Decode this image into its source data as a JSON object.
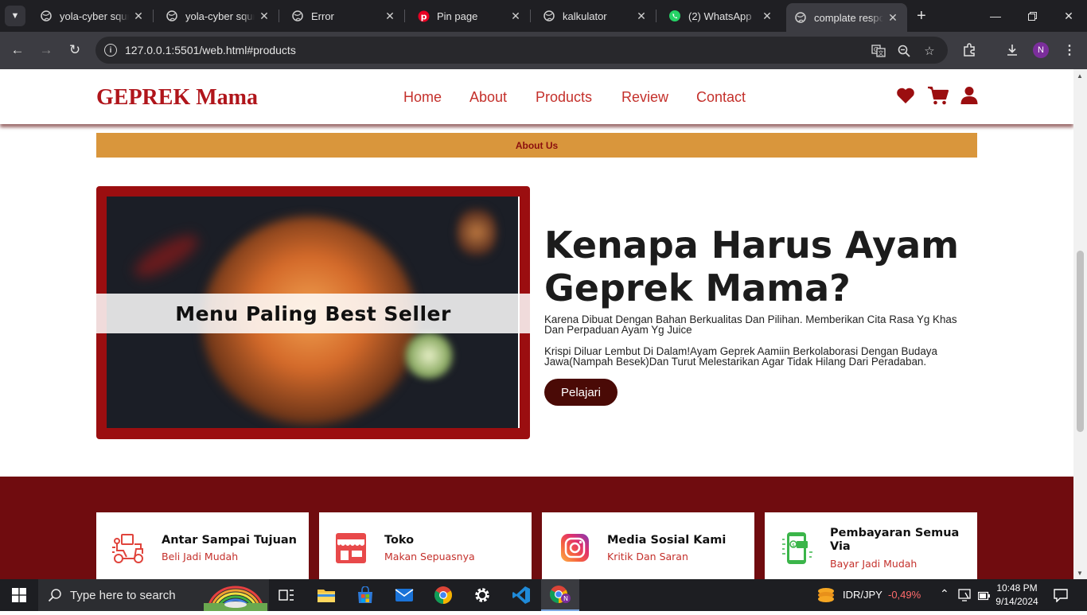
{
  "browser": {
    "tabs": [
      {
        "title": "yola-cyber squrit",
        "icon": "globe-icon"
      },
      {
        "title": "yola-cyber squrit",
        "icon": "globe-icon"
      },
      {
        "title": "Error",
        "icon": "globe-icon"
      },
      {
        "title": "Pin page",
        "icon": "pinterest-icon"
      },
      {
        "title": "kalkulator",
        "icon": "globe-icon"
      },
      {
        "title": "(2) WhatsApp",
        "icon": "whatsapp-icon"
      },
      {
        "title": "complate respon",
        "icon": "globe-icon",
        "active": true
      }
    ],
    "url": "127.0.0.1:5501/web.html#products",
    "profile_initial": "N"
  },
  "site": {
    "logo": "GEPREK Mama",
    "nav": [
      "Home",
      "About",
      "Products",
      "Review",
      "Contact"
    ],
    "header_icons": [
      "heart-icon",
      "cart-icon",
      "user-icon"
    ],
    "accent_color": "#c4302b",
    "about_bar": "About Us",
    "image_banner": "Menu Paling Best Seller",
    "why_title": "Kenapa Harus Ayam Geprek Mama?",
    "why_p1": "Karena Dibuat Dengan Bahan Berkualitas Dan Pilihan. Memberikan Cita Rasa Yg Khas Dan Perpaduan Ayam Yg Juice",
    "why_p2": "Krispi Diluar Lembut Di Dalam!Ayam Geprek Aamiin Berkolaborasi Dengan Budaya Jawa(Nampah Besek)Dan Turut Melestarikan Agar Tidak Hilang Dari Peradaban.",
    "learn_button": "Pelajari",
    "services": [
      {
        "title": "Antar Sampai Tujuan",
        "subtitle": "Beli Jadi Mudah",
        "icon": "delivery-scooter-icon"
      },
      {
        "title": "Toko",
        "subtitle": "Makan Sepuasnya",
        "icon": "store-icon"
      },
      {
        "title": "Media Sosial Kami",
        "subtitle": "Kritik Dan Saran",
        "icon": "instagram-icon"
      },
      {
        "title": "Pembayaran Semua Via",
        "subtitle": "Bayar Jadi Mudah",
        "icon": "payment-phone-icon"
      }
    ]
  },
  "taskbar": {
    "search_placeholder": "Type here to search",
    "currency": "IDR/JPY",
    "currency_change": "-0,49%",
    "time": "10:48 PM",
    "date": "9/14/2024"
  }
}
